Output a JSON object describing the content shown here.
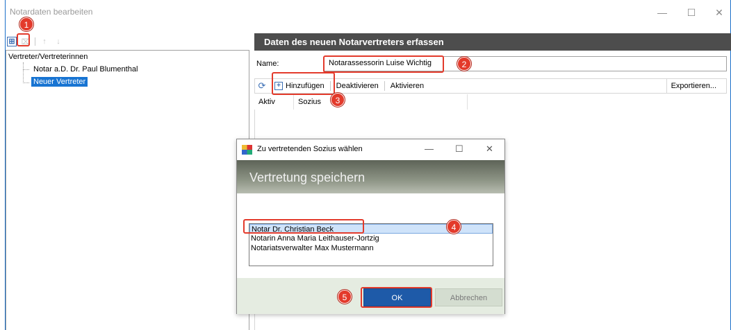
{
  "window": {
    "title": "Notardaten bearbeiten",
    "controls": {
      "minimize": "—",
      "maximize": "☐",
      "close": "✕"
    }
  },
  "left_toolbar": {
    "add_icon": "⊞",
    "remove_icon": "⌧",
    "up_icon": "↑",
    "down_icon": "↓"
  },
  "tree": {
    "root": "Vertreter/Vertreterinnen",
    "items": [
      "Notar a.D. Dr. Paul Blumenthal",
      "Neuer Vertreter"
    ]
  },
  "panel": {
    "header": "Daten des neuen Notarvertreters erfassen",
    "name_label": "Name:",
    "name_value": "Notarassessorin Luise Wichtig",
    "toolbar": {
      "refresh_icon": "⟳",
      "add": "Hinzufügen",
      "deactivate": "Deaktivieren",
      "activate": "Aktivieren",
      "export": "Exportieren..."
    },
    "columns": [
      "Aktiv",
      "Sozius"
    ]
  },
  "dialog": {
    "title": "Zu vertretenden Sozius wählen",
    "controls": {
      "minimize": "—",
      "maximize": "☐",
      "close": "✕"
    },
    "banner": "Vertretung speichern",
    "list": [
      "Notar Dr. Christian Beck",
      "Notarin Anna Maria Leithauser-Jortzig",
      "Notariatsverwalter Max Mustermann"
    ],
    "ok": "OK",
    "cancel": "Abbrechen"
  },
  "markers": [
    "1",
    "2",
    "3",
    "4",
    "5"
  ],
  "colors": {
    "accent": "#1874d2",
    "marker": "#e33a2b",
    "header_bg": "#4d4d4d",
    "ok_button": "#1e5aa8"
  }
}
